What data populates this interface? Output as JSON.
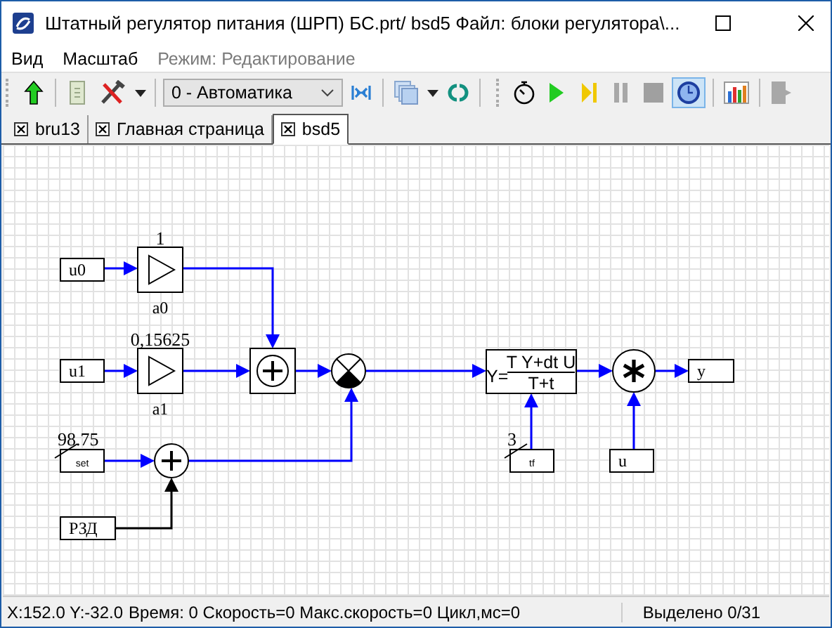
{
  "window": {
    "title": "Штатный регулятор питания (ШРП) БС.prt/ bsd5  Файл: блоки регулятора\\..."
  },
  "menu": [
    {
      "label": "Вид",
      "disabled": false
    },
    {
      "label": "Масштаб",
      "disabled": false
    },
    {
      "label": "Режим:  Редактирование",
      "disabled": true
    }
  ],
  "toolbar": {
    "mode_select": {
      "value": "0 - Автоматика"
    },
    "buttons": [
      {
        "kind": "up",
        "selected": false
      },
      {
        "kind": "script",
        "selected": false
      },
      {
        "kind": "tools",
        "selected": false
      },
      {
        "kind": "caret"
      },
      {
        "kind": "select"
      },
      {
        "kind": "link",
        "selected": false
      },
      {
        "kind": "layers",
        "selected": false
      },
      {
        "kind": "caret"
      },
      {
        "kind": "sync",
        "selected": false
      },
      {
        "kind": "stopwatch",
        "selected": false
      },
      {
        "kind": "play",
        "selected": false
      },
      {
        "kind": "step",
        "selected": false
      },
      {
        "kind": "pause",
        "selected": false
      },
      {
        "kind": "stop",
        "selected": false
      },
      {
        "kind": "clock",
        "selected": true
      },
      {
        "kind": "chart",
        "selected": false
      },
      {
        "kind": "exit",
        "selected": false
      }
    ]
  },
  "tabs": [
    {
      "label": "bru13",
      "selected": false
    },
    {
      "label": "Главная страница",
      "selected": false
    },
    {
      "label": "bsd5",
      "selected": true
    }
  ],
  "diagram": {
    "blocks": [
      {
        "kind": "input",
        "label": "u0"
      },
      {
        "kind": "gain",
        "name": "a0",
        "coefficient": "1"
      },
      {
        "kind": "input",
        "label": "u1"
      },
      {
        "kind": "gain",
        "name": "a1",
        "coefficient": "0,15625"
      },
      {
        "kind": "sum_box"
      },
      {
        "kind": "multiplier"
      },
      {
        "kind": "param",
        "label": "set",
        "value": "98.75"
      },
      {
        "kind": "sum"
      },
      {
        "kind": "input",
        "label": "РЗД"
      },
      {
        "kind": "formula",
        "prefix": "Y=",
        "numerator": "T Y+dt U",
        "denominator": "T+t"
      },
      {
        "kind": "param",
        "label": "tf",
        "value": "3"
      },
      {
        "kind": "input",
        "label": "u"
      },
      {
        "kind": "star"
      },
      {
        "kind": "output",
        "label": "y"
      }
    ]
  },
  "status_bar": {
    "coordinates": "X:152.0  Y:-32.0",
    "info": "Время: 0 Скорость=0 Макс.скорость=0 Цикл,мс=0",
    "selection": "Выделено 0/31"
  }
}
